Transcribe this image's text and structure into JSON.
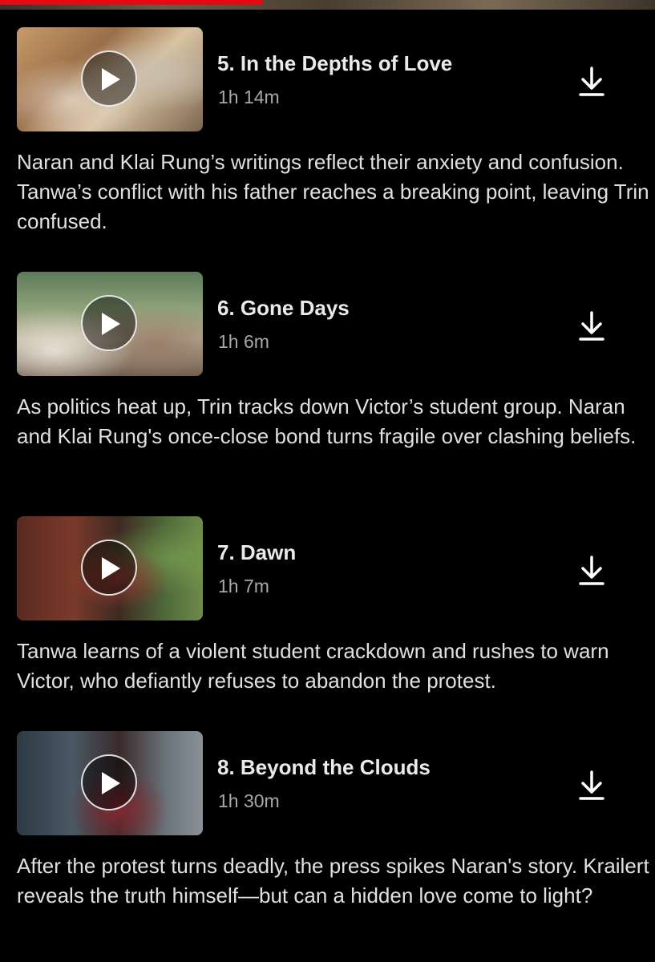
{
  "playback": {
    "progress_fraction": 0.4
  },
  "episodes": [
    {
      "title": "5. In the Depths of Love",
      "duration": "1h 14m",
      "description": "Naran and Klai Rung’s writings reflect their anxiety and confusion. Tanwa’s conflict with his father reaches a breaking point, leaving Trin confused."
    },
    {
      "title": "6. Gone Days",
      "duration": "1h 6m",
      "description": "As politics heat up, Trin tracks down Victor’s student group. Naran and Klai Rung's once-close bond turns fragile over clashing beliefs."
    },
    {
      "title": "7. Dawn",
      "duration": "1h 7m",
      "description": "Tanwa learns of a violent student crackdown and rushes to warn Victor, who defiantly refuses to abandon the protest."
    },
    {
      "title": "8. Beyond the Clouds",
      "duration": "1h 30m",
      "description": "After the protest turns deadly, the press spikes Naran's story. Krailert reveals the truth himself—but can a hidden love come to light?"
    }
  ],
  "icons": {
    "play": "play-icon",
    "download": "download-icon"
  },
  "colors": {
    "accent": "#e50914",
    "background": "#000000",
    "secondary_text": "#a8a8a8"
  }
}
